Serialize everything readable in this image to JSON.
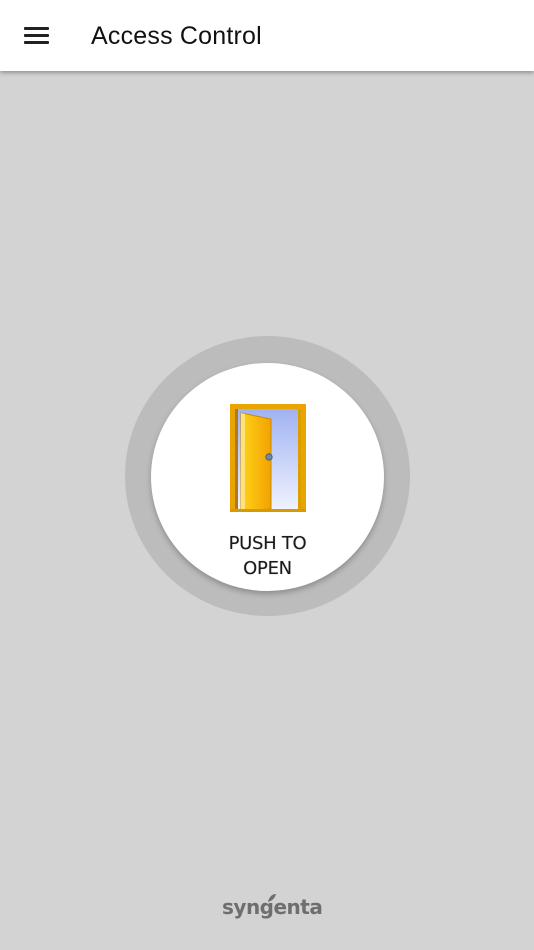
{
  "appbar": {
    "title": "Access Control",
    "menu_icon": "menu-icon"
  },
  "main": {
    "button": {
      "line1": "PUSH TO",
      "line2": "OPEN",
      "icon": "door-open-icon"
    }
  },
  "footer": {
    "brand": "syngenta"
  },
  "colors": {
    "background": "#d3d3d3",
    "appbar": "#ffffff",
    "ring": "#bcbcbc",
    "door": "#f5b000",
    "door_frame": "#e8a000",
    "sky": "#b9c6f5"
  }
}
